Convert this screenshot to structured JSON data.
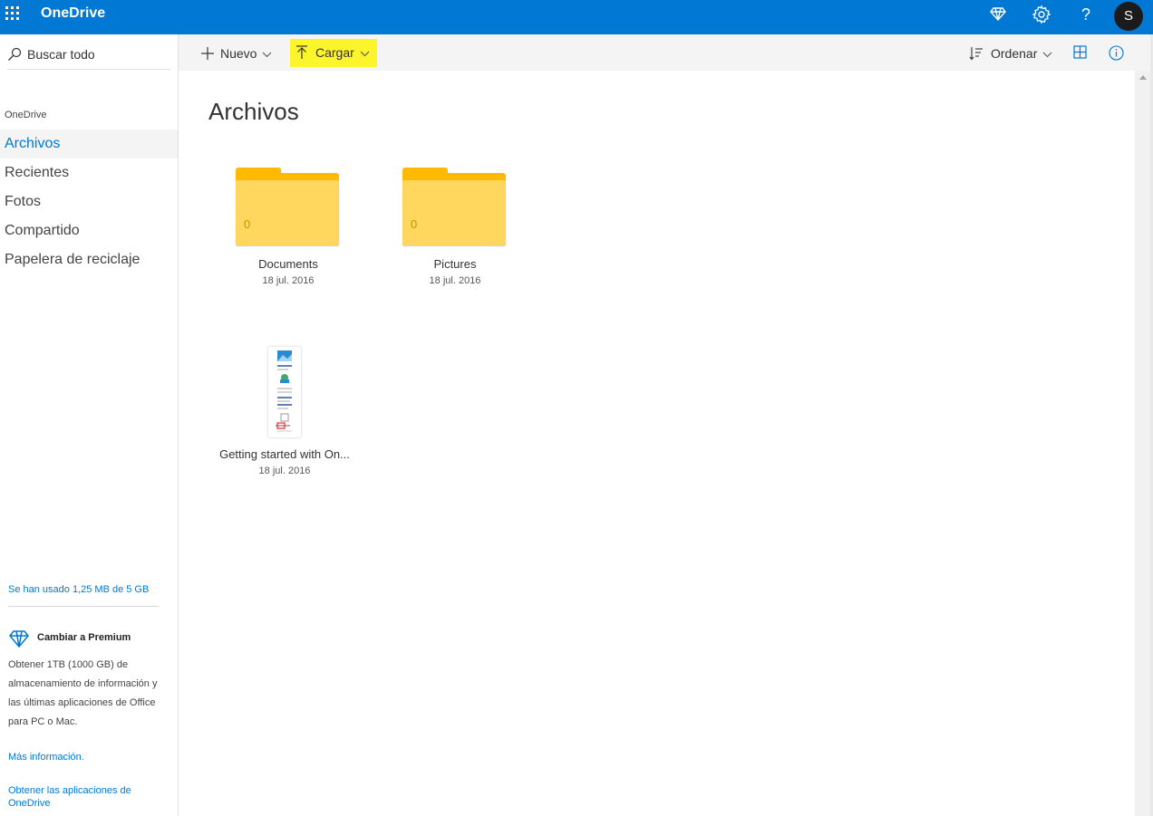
{
  "app": {
    "title": "OneDrive",
    "avatar_initial": "S"
  },
  "sidebar": {
    "search_label": "Buscar todo",
    "section_header": "OneDrive",
    "items": [
      {
        "label": "Archivos",
        "active": true
      },
      {
        "label": "Recientes",
        "active": false
      },
      {
        "label": "Fotos",
        "active": false
      },
      {
        "label": "Compartido",
        "active": false
      },
      {
        "label": "Papelera de reciclaje",
        "active": false
      }
    ],
    "storage_text": "Se han usado 1,25 MB de 5 GB",
    "premium_title": "Cambiar a Premium",
    "premium_text": "Obtener 1TB (1000 GB) de almacenamiento de información y las últimas aplicaciones de Office para PC o Mac.",
    "more_info": "Más información.",
    "apps_link": "Obtener las aplicaciones de OneDrive"
  },
  "toolbar": {
    "new_label": "Nuevo",
    "upload_label": "Cargar",
    "sort_label": "Ordenar",
    "highlight_color": "#fdf52c"
  },
  "main": {
    "title": "Archivos",
    "items": [
      {
        "name": "Documents",
        "date": "18 jul. 2016",
        "type": "folder",
        "count": "0"
      },
      {
        "name": "Pictures",
        "date": "18 jul. 2016",
        "type": "folder",
        "count": "0"
      },
      {
        "name": "Getting started with On...",
        "date": "18 jul. 2016",
        "type": "file"
      }
    ]
  },
  "colors": {
    "brand": "#0078d4",
    "folder": "#ffd75e",
    "folder_tab": "#ffb900"
  }
}
